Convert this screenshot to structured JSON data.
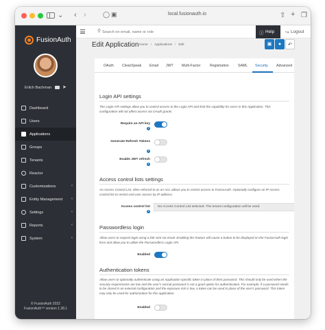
{
  "browser": {
    "url": "local.fusionauth.io"
  },
  "brand": {
    "name": "FusionAuth"
  },
  "user": {
    "name": "Erlich Bachman"
  },
  "nav": {
    "items": [
      {
        "label": "Dashboard",
        "icon": "dashboard-icon",
        "active": false,
        "chevron": false
      },
      {
        "label": "Users",
        "icon": "users-icon",
        "active": false,
        "chevron": false
      },
      {
        "label": "Applications",
        "icon": "applications-icon",
        "active": true,
        "chevron": false
      },
      {
        "label": "Groups",
        "icon": "groups-icon",
        "active": false,
        "chevron": false
      },
      {
        "label": "Tenants",
        "icon": "tenants-icon",
        "active": false,
        "chevron": false
      },
      {
        "label": "Reactor",
        "icon": "reactor-icon",
        "active": false,
        "chevron": false
      },
      {
        "label": "Customizations",
        "icon": "code-icon",
        "active": false,
        "chevron": true
      },
      {
        "label": "Entity Management",
        "icon": "entity-icon",
        "active": false,
        "chevron": true
      },
      {
        "label": "Settings",
        "icon": "gear-icon",
        "active": false,
        "chevron": true
      },
      {
        "label": "Reports",
        "icon": "chart-icon",
        "active": false,
        "chevron": true
      },
      {
        "label": "System",
        "icon": "monitor-icon",
        "active": false,
        "chevron": true
      }
    ],
    "footer_line1": "© FusionAuth 2022",
    "footer_line2": "FusionAuth™ version 1.38.1"
  },
  "topbar": {
    "search_placeholder": "Search on email, name or role",
    "help_label": "Help",
    "logout_label": "Logout"
  },
  "header": {
    "title": "Edit Application",
    "breadcrumb": [
      "Home",
      "Applications",
      "Edit"
    ]
  },
  "tabs": [
    {
      "label": "OAuth",
      "active": false
    },
    {
      "label": "CleanSpeak",
      "active": false
    },
    {
      "label": "Email",
      "active": false
    },
    {
      "label": "JWT",
      "active": false
    },
    {
      "label": "Multi-Factor",
      "active": false
    },
    {
      "label": "Registration",
      "active": false
    },
    {
      "label": "SAML",
      "active": false
    },
    {
      "label": "Security",
      "active": true
    },
    {
      "label": "Advanced",
      "active": false
    }
  ],
  "login_api": {
    "title": "Login API settings",
    "description": "The Login API settings allow you to control access to the Login API and limit the capability for users in this Application. This configuration will not affect access via OAuth grants.",
    "require_api_key": {
      "label": "Require an API key",
      "enabled": true
    },
    "generate_refresh_tokens": {
      "label": "Generate Refresh Tokens",
      "enabled": false
    },
    "enable_jwt_refresh": {
      "label": "Enable JWT refresh",
      "enabled": false
    }
  },
  "acl": {
    "title": "Access control lists settings",
    "description": "An Access Control List, often referred to as an ACL allows you to restrict access to FusionAuth. Optionally configure an IP Access Control list to restrict end user access by IP address.",
    "field_label": "Access control list",
    "selected_value": "No Access Control List selected. The tenant configuration will be used."
  },
  "passwordless": {
    "title": "Passwordless login",
    "description": "Allow users to request login using a link sent via email. Enabling this feature will cause a button to be displayed on the FusionAuth login form and allow you to utilize the Passwordless Login API.",
    "enabled_label": "Enabled",
    "enabled": true
  },
  "auth_tokens": {
    "title": "Authentication tokens",
    "description": "Allow users to optionally authenticate using an Application specific token in place of their password. This should only be used when the security requirements are low and the user's normal password is not a good option for authentication. For example, if a password needs to be stored in an external configuration and the exposure risk is low, a token can be used in place of the user's password. This token may only be used for authorization for this application.",
    "enabled_label": "Enabled",
    "enabled": false
  },
  "colors": {
    "accent": "#1d78c1",
    "nav_bg": "#2c3036",
    "brand": "#f58320"
  }
}
